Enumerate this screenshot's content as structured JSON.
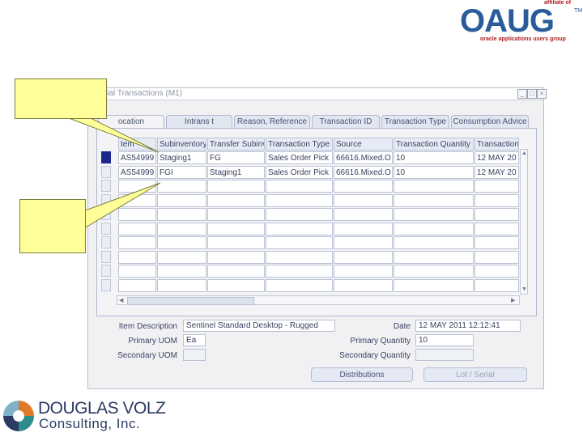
{
  "oaug_logo": {
    "affiliate_text": "affiliate of",
    "letters": "OAUG",
    "trademark": "TM",
    "subtitle": "oracle applications users group"
  },
  "window": {
    "title": "aterial Transactions (M1)"
  },
  "tabs": [
    {
      "label": "ocation",
      "active": true
    },
    {
      "label": "Intrans t",
      "active": false
    },
    {
      "label": "Reason, Reference",
      "active": false
    },
    {
      "label": "Transaction ID",
      "active": false
    },
    {
      "label": "Transaction Type",
      "active": false
    },
    {
      "label": "Consumption Advice",
      "active": false
    }
  ],
  "table": {
    "headers": [
      "tem",
      "Subinventory",
      "Transfer Subinv",
      "Transaction Type",
      "Source",
      "Transaction Quantity",
      "Transaction"
    ],
    "rows": [
      [
        "AS54999",
        "Staging1",
        "FG",
        "Sales Order Pick",
        "66616.Mixed.O",
        "10",
        "12 MAY 20"
      ],
      [
        "AS54999",
        "FGI",
        "Staging1",
        "Sales Order Pick",
        "66616.Mixed.O",
        "10",
        "12 MAY 20"
      ]
    ],
    "empty_rows": 8,
    "selected_row": 0
  },
  "details": {
    "item_description_label": "Item Description",
    "item_description_value": "Sentinel Standard Desktop - Rugged",
    "date_label": "Date",
    "date_value": "12 MAY 2011 12:12:41",
    "primary_uom_label": "Primary UOM",
    "primary_uom_value": "Ea",
    "primary_quantity_label": "Primary Quantity",
    "primary_quantity_value": "10",
    "secondary_uom_label": "Secondary UOM",
    "secondary_uom_value": "",
    "secondary_quantity_label": "Secondary Quantity",
    "secondary_quantity_value": ""
  },
  "buttons": {
    "distributions": "Distributions",
    "lot_serial": "Lot / Serial"
  },
  "dv_logo": {
    "name": "DOUGLAS VOLZ",
    "subtitle": "Consulting, Inc."
  },
  "colors": {
    "callout": "#ffff99",
    "selection": "#1b2a8a",
    "oaug_blue": "#2a5b9a",
    "oaug_red": "#b01c1c"
  }
}
